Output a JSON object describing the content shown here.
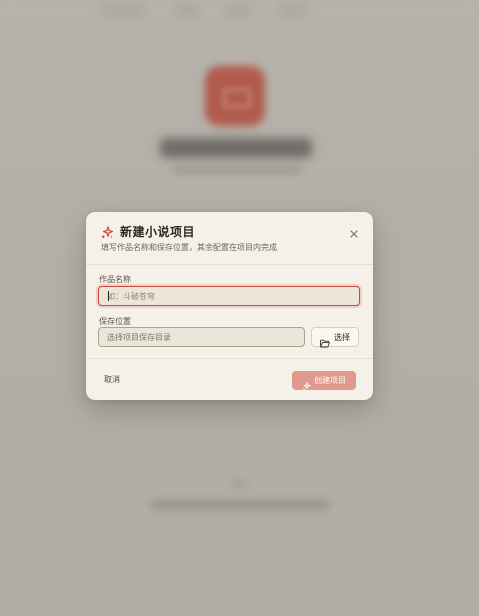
{
  "dialog": {
    "title": "新建小说项目",
    "subtitle": "填写作品名称和保存位置，其余配置在项目内完成",
    "close_icon": "close-icon",
    "title_icon": "sparkle-icon"
  },
  "form": {
    "name_label": "作品名称",
    "name_value": "",
    "name_placeholder": "如：斗破苍穹",
    "path_label": "保存位置",
    "path_value": "",
    "path_placeholder": "选择项目保存目录",
    "choose_label": "选择",
    "choose_icon": "folder-open-icon"
  },
  "footer": {
    "cancel_label": "取消",
    "create_label": "创建项目",
    "create_icon": "sparkle-icon"
  },
  "colors": {
    "accent": "#c44b3d",
    "create_button": "#e09a8d",
    "dialog_bg": "#f6f1e8"
  }
}
